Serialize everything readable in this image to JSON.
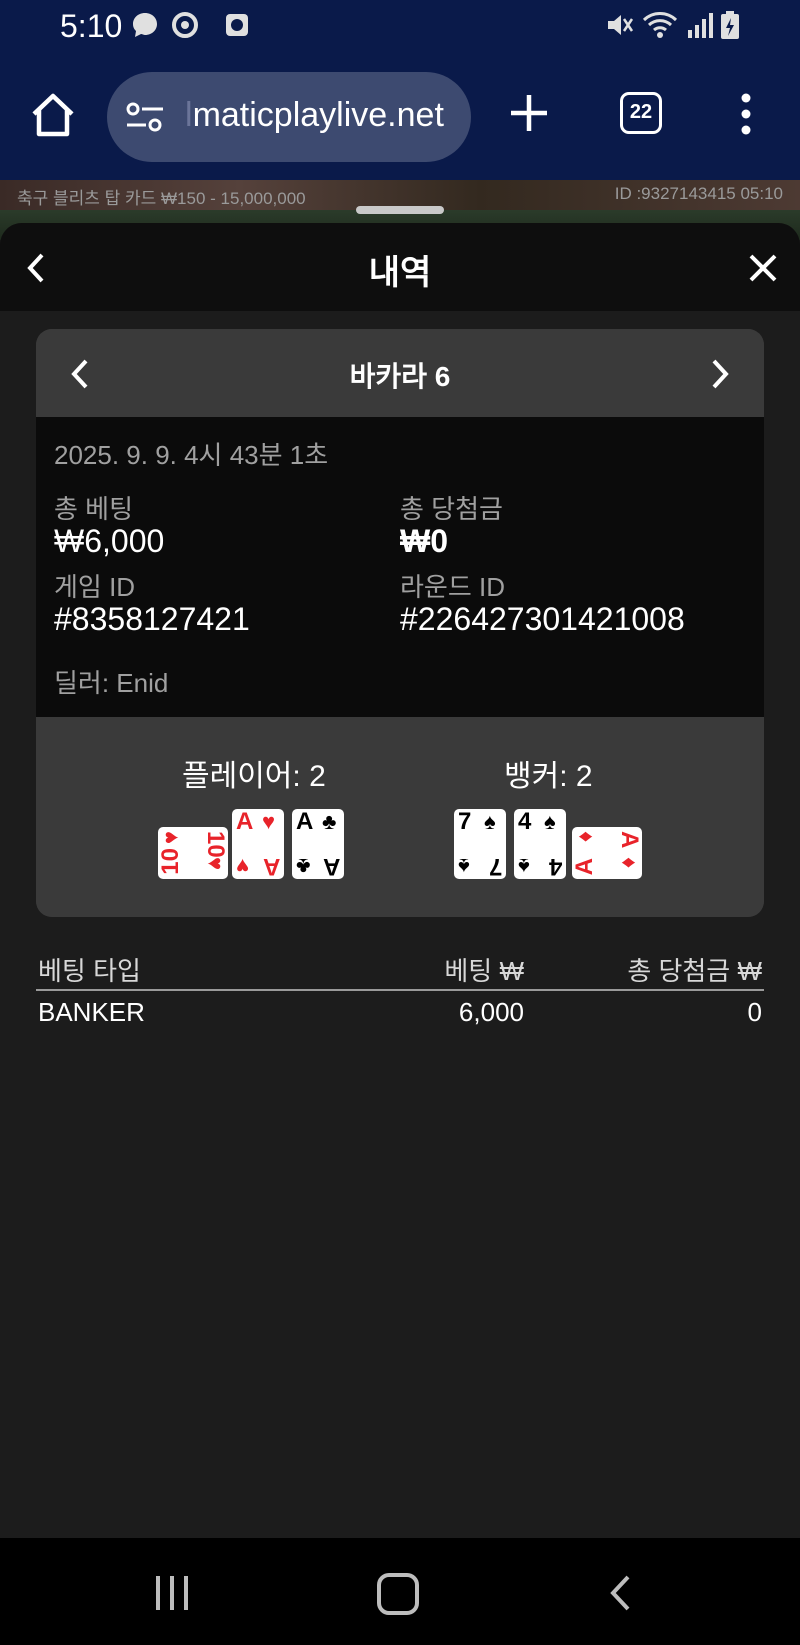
{
  "status_bar": {
    "time": "5:10",
    "icons": [
      "messenger-icon",
      "sync-icon",
      "screen-record-icon",
      "mute-icon",
      "wifi-icon",
      "signal-icon",
      "battery-icon"
    ]
  },
  "browser": {
    "url_faded": "l",
    "url": "maticplaylive.net",
    "tab_count": "22"
  },
  "game_strip": {
    "left_text": "축구 블리츠 탑 카드 ₩150 - 15,000,000",
    "right_text": "ID :9327143415 05:10"
  },
  "sheet": {
    "title": "내역"
  },
  "round": {
    "title": "바카라 6",
    "datetime": "2025. 9. 9. 4시 43분 1초",
    "total_bet_label": "총 베팅",
    "total_bet_value": "₩6,000",
    "total_win_label": "총 당첨금",
    "total_win_value": "₩0",
    "game_id_label": "게임 ID",
    "game_id_value": "#8358127421",
    "round_id_label": "라운드 ID",
    "round_id_value": "#226427301421008",
    "dealer": "딜러: Enid"
  },
  "hands": {
    "player_label": "플레이어: 2",
    "banker_label": "뱅커: 2",
    "player_cards": [
      {
        "rank": "10",
        "suit": "♥",
        "color": "#e8232a",
        "sideways": true
      },
      {
        "rank": "A",
        "suit": "♥",
        "color": "#e8232a",
        "sideways": false
      },
      {
        "rank": "A",
        "suit": "♣",
        "color": "#000000",
        "sideways": false
      }
    ],
    "banker_cards": [
      {
        "rank": "7",
        "suit": "♠",
        "color": "#000000",
        "sideways": false
      },
      {
        "rank": "4",
        "suit": "♠",
        "color": "#000000",
        "sideways": false
      },
      {
        "rank": "A",
        "suit": "♦",
        "color": "#e8232a",
        "sideways": true
      }
    ]
  },
  "bets": {
    "headers": [
      "베팅 타입",
      "베팅 ₩",
      "총 당첨금 ₩"
    ],
    "rows": [
      {
        "type": "BANKER",
        "bet": "6,000",
        "win": "0"
      }
    ]
  }
}
